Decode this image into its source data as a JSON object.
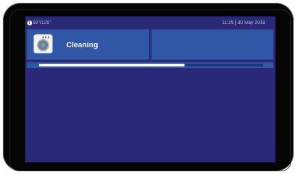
{
  "status_bar": {
    "temperature": "92°/125°",
    "clock": "11:25 | 30 May 2019"
  },
  "appliance": {
    "icon": "washing-machine-icon",
    "status": "Cleaning"
  },
  "progress": {
    "fraction": 0.65
  },
  "colors": {
    "screen_bg": "#2a2878",
    "panel": "#3056a6",
    "progress_fill": "#ffffff"
  }
}
